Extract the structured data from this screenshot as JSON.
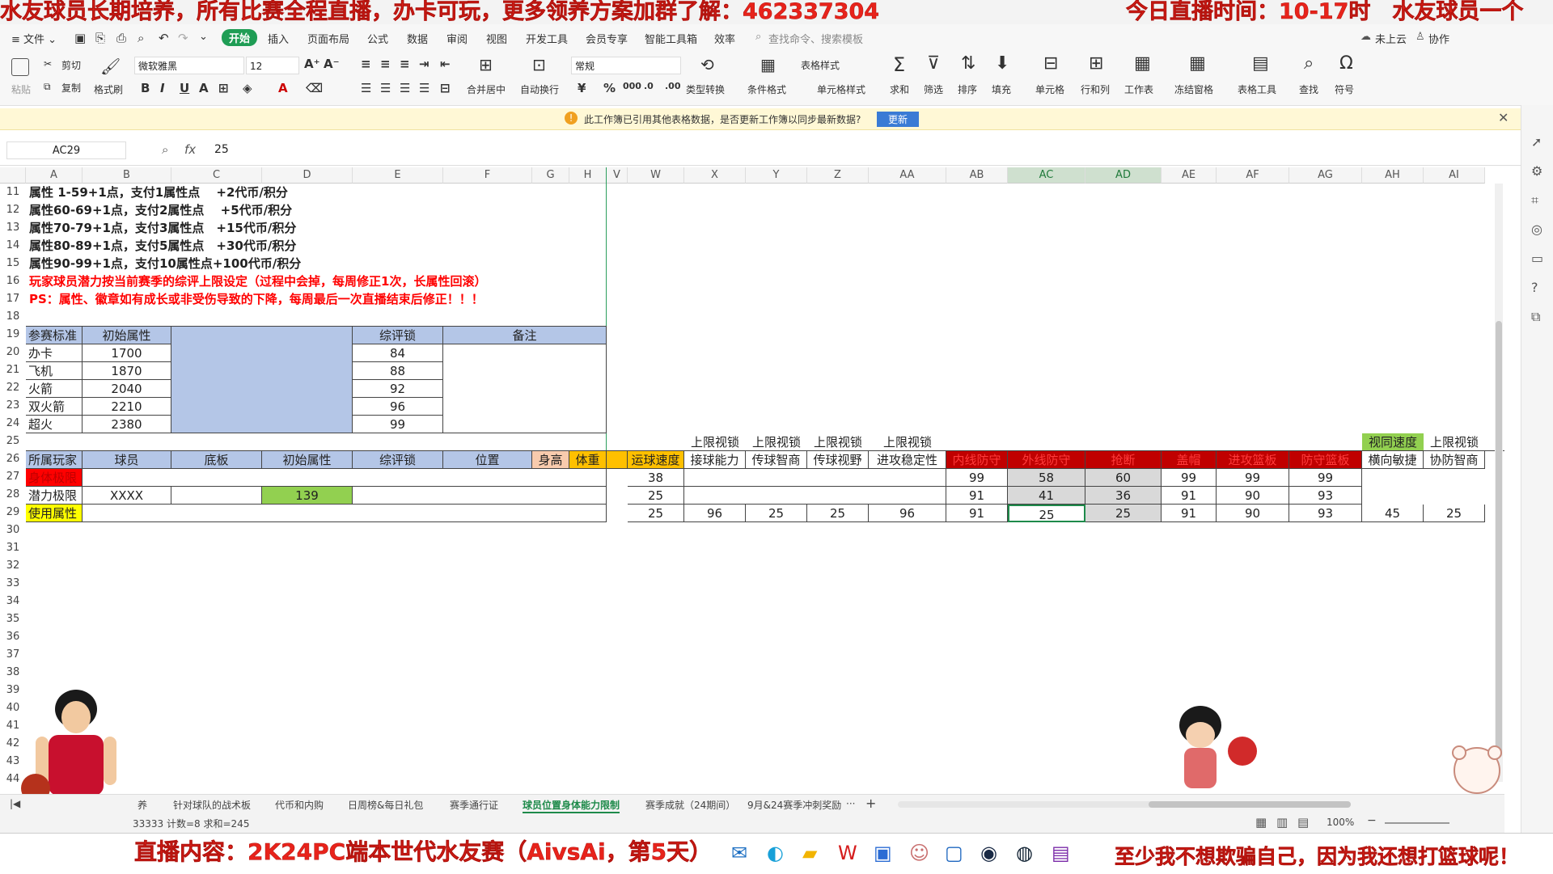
{
  "banner": {
    "left": "水友球员长期培养，所有比赛全程直播，办卡可玩，更多领养方案加群了解：462337304",
    "right": "今日直播时间：10-17时　水友球员一个"
  },
  "menu": {
    "file": "≡ 文件 ⌄",
    "items": [
      "开始",
      "插入",
      "页面布局",
      "公式",
      "数据",
      "审阅",
      "视图",
      "开发工具",
      "会员专享",
      "智能工具箱",
      "效率"
    ],
    "search_placeholder": "查找命令、搜索模板",
    "cloud": "未上云",
    "collab": "协作"
  },
  "ribbon": {
    "paste": "粘贴",
    "cut": "剪切",
    "copy": "复制",
    "format_painter": "格式刷",
    "font": "微软雅黑",
    "size": "12",
    "merge": "合并居中",
    "wrap": "自动换行",
    "number_format": "常规",
    "type_convert": "类型转换",
    "cond_format": "条件格式",
    "table_style": "表格样式",
    "cell_style": "单元格样式",
    "sum": "求和",
    "filter": "筛选",
    "sort": "排序",
    "fill": "填充",
    "cell": "单元格",
    "rowcol": "行和列",
    "sheet": "工作表",
    "freeze": "冻结窗格",
    "table_tools": "表格工具",
    "find": "查找",
    "symbol": "符号"
  },
  "notice": {
    "text": "此工作簿已引用其他表格数据，是否更新工作簿以同步最新数据?",
    "button": "更新"
  },
  "formula": {
    "cell_ref": "AC29",
    "fx": "fx",
    "value": "25"
  },
  "columns": [
    "A",
    "B",
    "C",
    "D",
    "E",
    "F",
    "G",
    "H",
    "V",
    "W",
    "X",
    "Y",
    "Z",
    "AA",
    "AB",
    "AC",
    "AD",
    "AE",
    "AF",
    "AG",
    "AH",
    "AI"
  ],
  "rows": {
    "r11": "属性 1-59+1点，支付1属性点　 +2代币/积分",
    "r12": "属性60-69+1点，支付2属性点　 +5代币/积分",
    "r13": "属性70-79+1点，支付3属性点　+15代币/积分",
    "r14": "属性80-89+1点，支付5属性点　+30代币/积分",
    "r15": "属性90-99+1点，支付10属性点+100代币/积分",
    "r16": "玩家球员潜力按当前赛季的综评上限设定（过程中会掉，每周修正1次，长属性回滚）",
    "r17": "PS：属性、徽章如有成长或非受伤导致的下降，每周最后一次直播结束后修正！！！"
  },
  "tier_table": {
    "headers": [
      "参赛标准",
      "初始属性",
      "综评锁",
      "备注"
    ],
    "rows": [
      {
        "name": "办卡",
        "attr": "1700",
        "lock": "84"
      },
      {
        "name": "飞机",
        "attr": "1870",
        "lock": "88"
      },
      {
        "name": "火箭",
        "attr": "2040",
        "lock": "92"
      },
      {
        "name": "双火箭",
        "attr": "2210",
        "lock": "96"
      },
      {
        "name": "超火",
        "attr": "2380",
        "lock": "99"
      }
    ]
  },
  "player_table": {
    "headers": [
      "所属玩家",
      "球员",
      "底板",
      "初始属性",
      "综评锁",
      "位置",
      "身高",
      "体重"
    ],
    "row_labels": [
      "身体极限",
      "潜力极限",
      "使用属性"
    ],
    "player": "XXXX",
    "potential": "139"
  },
  "stats": {
    "row25": {
      "X": "上限视锁",
      "Y": "上限视锁",
      "Z": "上限视锁",
      "AA": "上限视锁",
      "AH": "视同速度",
      "AI": "上限视锁"
    },
    "row26": {
      "W": "运球速度",
      "X": "接球能力",
      "Y": "传球智商",
      "Z": "传球视野",
      "AA": "进攻稳定性",
      "AB": "内线防守",
      "AC": "外线防守",
      "AD": "抢断",
      "AE": "盖帽",
      "AF": "进攻篮板",
      "AG": "防守篮板",
      "AH": "横向敏捷",
      "AI": "协防智商"
    },
    "row27": {
      "W": "38",
      "AB": "99",
      "AC": "58",
      "AD": "60",
      "AE": "99",
      "AF": "99",
      "AG": "99"
    },
    "row28": {
      "W": "25",
      "AB": "91",
      "AC": "41",
      "AD": "36",
      "AE": "91",
      "AF": "90",
      "AG": "93"
    },
    "row29": {
      "W": "25",
      "X": "96",
      "Y": "25",
      "Z": "25",
      "AA": "96",
      "AB": "91",
      "AC": "25",
      "AD": "25",
      "AE": "91",
      "AF": "90",
      "AG": "93",
      "AH": "45",
      "AI": "25"
    }
  },
  "sheet_tabs": [
    "养",
    "针对球队的战术板",
    "代币和内购",
    "日周榜&每日礼包",
    "赛季通行证",
    "球员位置身体能力限制",
    "赛季成就（24期间）",
    "9月&24赛季冲刺奖励"
  ],
  "active_tab": "球员位置身体能力限制",
  "status": {
    "summary": "33333  计数=8  求和=245",
    "zoom": "100%"
  },
  "bottom_banner": {
    "left": "直播内容：2K24PC端本世代水友赛（AivsAi，第5天）",
    "right": "至少我不想欺骗自己，因为我还想打篮球呢！"
  },
  "colors": {
    "banner_red": "#e8231b",
    "header_blue": "#b4c6e7",
    "dark_red": "#c00000",
    "red": "#ff0000",
    "orange": "#ffc000",
    "green": "#92d050",
    "yellow": "#ffff00",
    "selected_gray": "#d9d9d9"
  },
  "icons": [
    "file-icon",
    "save-icon",
    "print-icon",
    "undo-icon",
    "redo-icon",
    "search-icon",
    "cloud-icon",
    "paste-icon",
    "scissors-icon",
    "copy-icon",
    "brush-icon",
    "bold-icon",
    "italic-icon",
    "underline-icon",
    "sum-icon",
    "filter-icon",
    "sort-icon",
    "fill-icon",
    "find-icon",
    "symbol-icon",
    "warning-icon",
    "close-icon",
    "zoom-icon",
    "fx-icon",
    "taskbar-mail-icon",
    "taskbar-edge-icon",
    "taskbar-folder-icon",
    "taskbar-wps-icon",
    "taskbar-steam-icon"
  ]
}
